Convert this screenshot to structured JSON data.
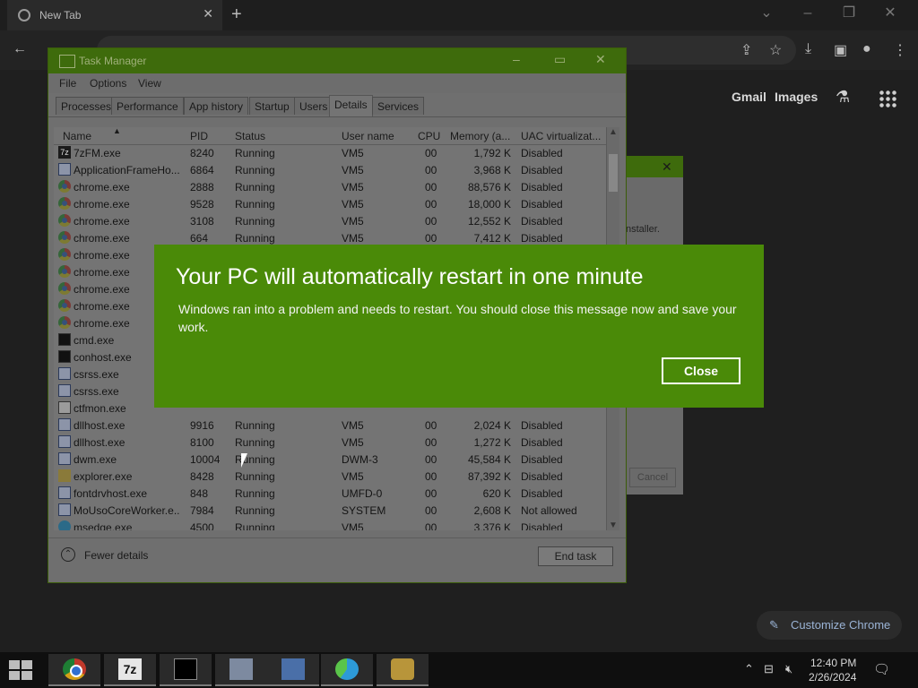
{
  "browser": {
    "tab_title": "New Tab",
    "header_links": [
      "Gmail",
      "Images"
    ],
    "customize_label": "Customize Chrome"
  },
  "task_manager": {
    "title": "Task Manager",
    "menu": [
      "File",
      "Options",
      "View"
    ],
    "tabs": [
      "Processes",
      "Performance",
      "App history",
      "Startup",
      "Users",
      "Details",
      "Services"
    ],
    "active_tab": "Details",
    "columns": [
      "Name",
      "PID",
      "Status",
      "User name",
      "CPU",
      "Memory (a...",
      "UAC virtualizat..."
    ],
    "rows": [
      {
        "name": "7zFM.exe",
        "pid": "8240",
        "status": "Running",
        "user": "VM5",
        "cpu": "00",
        "mem": "1,792 K",
        "uac": "Disabled",
        "icon": "7z"
      },
      {
        "name": "ApplicationFrameHo...",
        "pid": "6864",
        "status": "Running",
        "user": "VM5",
        "cpu": "00",
        "mem": "3,968 K",
        "uac": "Disabled",
        "icon": "box"
      },
      {
        "name": "chrome.exe",
        "pid": "2888",
        "status": "Running",
        "user": "VM5",
        "cpu": "00",
        "mem": "88,576 K",
        "uac": "Disabled",
        "icon": "chrome"
      },
      {
        "name": "chrome.exe",
        "pid": "9528",
        "status": "Running",
        "user": "VM5",
        "cpu": "00",
        "mem": "18,000 K",
        "uac": "Disabled",
        "icon": "chrome"
      },
      {
        "name": "chrome.exe",
        "pid": "3108",
        "status": "Running",
        "user": "VM5",
        "cpu": "00",
        "mem": "12,552 K",
        "uac": "Disabled",
        "icon": "chrome"
      },
      {
        "name": "chrome.exe",
        "pid": "664",
        "status": "Running",
        "user": "VM5",
        "cpu": "00",
        "mem": "7,412 K",
        "uac": "Disabled",
        "icon": "chrome"
      },
      {
        "name": "chrome.exe",
        "pid": "",
        "status": "",
        "user": "",
        "cpu": "",
        "mem": "",
        "uac": "",
        "icon": "chrome"
      },
      {
        "name": "chrome.exe",
        "pid": "",
        "status": "",
        "user": "",
        "cpu": "",
        "mem": "",
        "uac": "",
        "icon": "chrome"
      },
      {
        "name": "chrome.exe",
        "pid": "",
        "status": "",
        "user": "",
        "cpu": "",
        "mem": "",
        "uac": "",
        "icon": "chrome"
      },
      {
        "name": "chrome.exe",
        "pid": "",
        "status": "",
        "user": "",
        "cpu": "",
        "mem": "",
        "uac": "",
        "icon": "chrome"
      },
      {
        "name": "chrome.exe",
        "pid": "",
        "status": "",
        "user": "",
        "cpu": "",
        "mem": "",
        "uac": "",
        "icon": "chrome"
      },
      {
        "name": "cmd.exe",
        "pid": "",
        "status": "",
        "user": "",
        "cpu": "",
        "mem": "",
        "uac": "",
        "icon": "cmd"
      },
      {
        "name": "conhost.exe",
        "pid": "",
        "status": "",
        "user": "",
        "cpu": "",
        "mem": "",
        "uac": "",
        "icon": "cmd"
      },
      {
        "name": "csrss.exe",
        "pid": "",
        "status": "",
        "user": "",
        "cpu": "",
        "mem": "",
        "uac": "",
        "icon": "box"
      },
      {
        "name": "csrss.exe",
        "pid": "",
        "status": "",
        "user": "",
        "cpu": "",
        "mem": "",
        "uac": "",
        "icon": "box"
      },
      {
        "name": "ctfmon.exe",
        "pid": "",
        "status": "",
        "user": "",
        "cpu": "",
        "mem": "",
        "uac": "",
        "icon": "pen"
      },
      {
        "name": "dllhost.exe",
        "pid": "9916",
        "status": "Running",
        "user": "VM5",
        "cpu": "00",
        "mem": "2,024 K",
        "uac": "Disabled",
        "icon": "box"
      },
      {
        "name": "dllhost.exe",
        "pid": "8100",
        "status": "Running",
        "user": "VM5",
        "cpu": "00",
        "mem": "1,272 K",
        "uac": "Disabled",
        "icon": "box"
      },
      {
        "name": "dwm.exe",
        "pid": "10004",
        "status": "Running",
        "user": "DWM-3",
        "cpu": "00",
        "mem": "45,584 K",
        "uac": "Disabled",
        "icon": "box"
      },
      {
        "name": "explorer.exe",
        "pid": "8428",
        "status": "Running",
        "user": "VM5",
        "cpu": "00",
        "mem": "87,392 K",
        "uac": "Disabled",
        "icon": "folder"
      },
      {
        "name": "fontdrvhost.exe",
        "pid": "848",
        "status": "Running",
        "user": "UMFD-0",
        "cpu": "00",
        "mem": "620 K",
        "uac": "Disabled",
        "icon": "box"
      },
      {
        "name": "MoUsoCoreWorker.e...",
        "pid": "7984",
        "status": "Running",
        "user": "SYSTEM",
        "cpu": "00",
        "mem": "2,608 K",
        "uac": "Not allowed",
        "icon": "box"
      },
      {
        "name": "msedge.exe",
        "pid": "4500",
        "status": "Running",
        "user": "VM5",
        "cpu": "00",
        "mem": "3,376 K",
        "uac": "Disabled",
        "icon": "edge"
      }
    ],
    "fewer_details": "Fewer details",
    "end_task": "End task"
  },
  "installer": {
    "partial_text": "nstaller.",
    "cancel_label": "Cancel"
  },
  "restart_dialog": {
    "title": "Your PC will automatically restart in one minute",
    "message": "Windows ran into a problem and needs to restart. You should close this message now and save your work.",
    "close_label": "Close",
    "color": "#4a8a08"
  },
  "taskbar": {
    "time": "12:40 PM",
    "date": "2/26/2024"
  }
}
